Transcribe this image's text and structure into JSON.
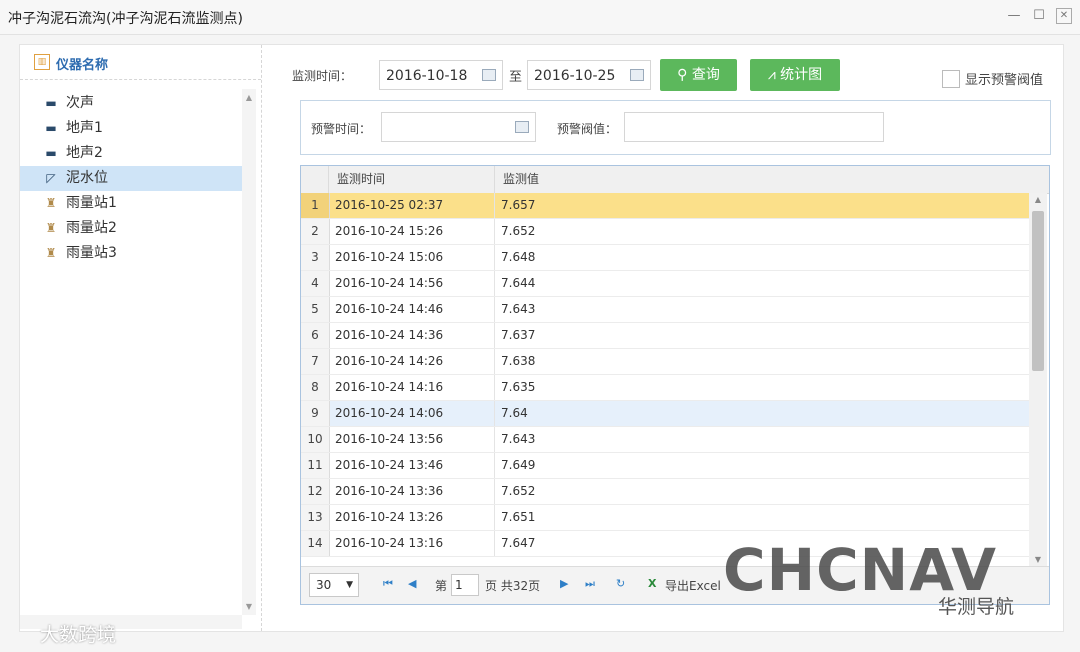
{
  "window": {
    "title": "冲子沟泥石流沟(冲子沟泥石流监测点)",
    "minimize": "—",
    "maximize": "☐",
    "close": "✕"
  },
  "sidebar": {
    "header_icon": "bar-chart-icon",
    "header": "仪器名称",
    "items": [
      {
        "label": "次声",
        "icon": "sensor-icon"
      },
      {
        "label": "地声1",
        "icon": "sensor-icon"
      },
      {
        "label": "地声2",
        "icon": "sensor-icon"
      },
      {
        "label": "泥水位",
        "icon": "level-icon"
      },
      {
        "label": "雨量站1",
        "icon": "rain-gauge-icon"
      },
      {
        "label": "雨量站2",
        "icon": "rain-gauge-icon"
      },
      {
        "label": "雨量站3",
        "icon": "rain-gauge-icon"
      }
    ],
    "selected_index": 3
  },
  "filter": {
    "time_label": "监测时间：",
    "start_date": "2016-10-18",
    "to_label": "至",
    "end_date": "2016-10-25",
    "query_button": "查询",
    "chart_button": "统计图",
    "show_threshold_label": "显示预警阀值",
    "warn_time_label": "预警时间：",
    "warn_value_label": "预警阀值："
  },
  "grid": {
    "columns": [
      "监测时间",
      "监测值"
    ],
    "rows": [
      [
        "1",
        "2016-10-25 02:37",
        "7.657"
      ],
      [
        "2",
        "2016-10-24 15:26",
        "7.652"
      ],
      [
        "3",
        "2016-10-24 15:06",
        "7.648"
      ],
      [
        "4",
        "2016-10-24 14:56",
        "7.644"
      ],
      [
        "5",
        "2016-10-24 14:46",
        "7.643"
      ],
      [
        "6",
        "2016-10-24 14:36",
        "7.637"
      ],
      [
        "7",
        "2016-10-24 14:26",
        "7.638"
      ],
      [
        "8",
        "2016-10-24 14:16",
        "7.635"
      ],
      [
        "9",
        "2016-10-24 14:06",
        "7.64"
      ],
      [
        "10",
        "2016-10-24 13:56",
        "7.643"
      ],
      [
        "11",
        "2016-10-24 13:46",
        "7.649"
      ],
      [
        "12",
        "2016-10-24 13:36",
        "7.652"
      ],
      [
        "13",
        "2016-10-24 13:26",
        "7.651"
      ],
      [
        "14",
        "2016-10-24 13:16",
        "7.647"
      ]
    ],
    "selected_row": 0,
    "hover_row": 8
  },
  "pager": {
    "page_size": "30",
    "page_prefix": "第",
    "current_page": "1",
    "page_suffix": "页 共32页",
    "export_label": "导出Excel"
  },
  "watermark": {
    "brand": "CHCNAV",
    "wechat": "华测导航",
    "source": "大数跨境"
  }
}
